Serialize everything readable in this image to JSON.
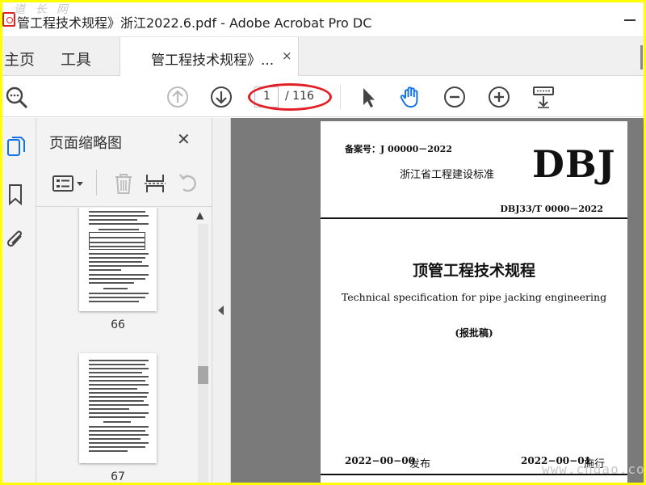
{
  "window": {
    "title": "管工程技术规程》浙江2022.6.pdf - Adobe Acrobat Pro DC"
  },
  "watermarks": {
    "top_left": "道 长 网",
    "bottom_right": "www.cndao.co"
  },
  "tabs": {
    "home": "主页",
    "tools": "工具",
    "document": "管工程技术规程》...",
    "close": "×"
  },
  "toolbar": {
    "page_current": "1",
    "page_total": "/ 116",
    "icons": [
      "search-icon",
      "page-up-icon",
      "page-down-icon",
      "select-cursor-icon",
      "hand-tool-icon",
      "zoom-out-icon",
      "zoom-in-icon",
      "keyboard-dropdown-icon"
    ],
    "hand_tool_color": "#1473e6",
    "highlight_color": "#e21f26"
  },
  "nav_rail": {
    "icons": [
      "page-thumbnails-icon",
      "bookmark-icon",
      "attachment-icon"
    ],
    "active_color": "#1473e6"
  },
  "thumbnails_panel": {
    "title": "页面缩略图",
    "close": "✕",
    "tools": [
      "thumbnail-options-icon",
      "delete-icon",
      "extract-icon",
      "rotate-icon"
    ],
    "pages": [
      {
        "label": "66"
      },
      {
        "label": "67"
      }
    ]
  },
  "document_page": {
    "filing_no": "备案号：J 00000－2022",
    "standard_name": "浙江省工程建设标准",
    "badge": "DBJ",
    "standard_no": "DBJ33/T 0000－2022",
    "title_cn": "顶管工程技术规程",
    "title_en": "Technical specification for pipe jacking engineering",
    "status": "(报批稿)",
    "publish_date": "2022−00−00",
    "publish_label": "发布",
    "effective_date": "2022−00−01",
    "effective_label": "施行"
  }
}
